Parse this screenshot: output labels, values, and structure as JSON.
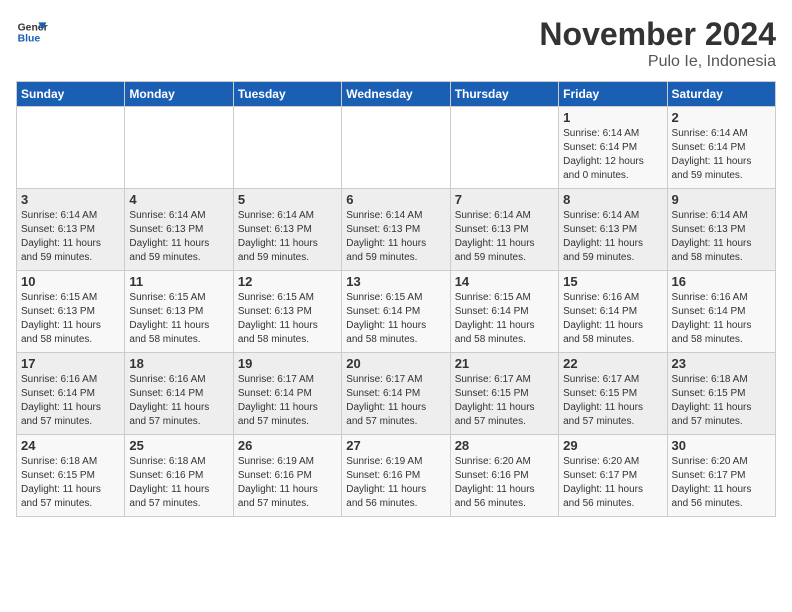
{
  "logo": {
    "line1": "General",
    "line2": "Blue"
  },
  "title": "November 2024",
  "location": "Pulo Ie, Indonesia",
  "days_of_week": [
    "Sunday",
    "Monday",
    "Tuesday",
    "Wednesday",
    "Thursday",
    "Friday",
    "Saturday"
  ],
  "weeks": [
    [
      {
        "day": "",
        "text": ""
      },
      {
        "day": "",
        "text": ""
      },
      {
        "day": "",
        "text": ""
      },
      {
        "day": "",
        "text": ""
      },
      {
        "day": "",
        "text": ""
      },
      {
        "day": "1",
        "text": "Sunrise: 6:14 AM\nSunset: 6:14 PM\nDaylight: 12 hours\nand 0 minutes."
      },
      {
        "day": "2",
        "text": "Sunrise: 6:14 AM\nSunset: 6:14 PM\nDaylight: 11 hours\nand 59 minutes."
      }
    ],
    [
      {
        "day": "3",
        "text": "Sunrise: 6:14 AM\nSunset: 6:13 PM\nDaylight: 11 hours\nand 59 minutes."
      },
      {
        "day": "4",
        "text": "Sunrise: 6:14 AM\nSunset: 6:13 PM\nDaylight: 11 hours\nand 59 minutes."
      },
      {
        "day": "5",
        "text": "Sunrise: 6:14 AM\nSunset: 6:13 PM\nDaylight: 11 hours\nand 59 minutes."
      },
      {
        "day": "6",
        "text": "Sunrise: 6:14 AM\nSunset: 6:13 PM\nDaylight: 11 hours\nand 59 minutes."
      },
      {
        "day": "7",
        "text": "Sunrise: 6:14 AM\nSunset: 6:13 PM\nDaylight: 11 hours\nand 59 minutes."
      },
      {
        "day": "8",
        "text": "Sunrise: 6:14 AM\nSunset: 6:13 PM\nDaylight: 11 hours\nand 59 minutes."
      },
      {
        "day": "9",
        "text": "Sunrise: 6:14 AM\nSunset: 6:13 PM\nDaylight: 11 hours\nand 58 minutes."
      }
    ],
    [
      {
        "day": "10",
        "text": "Sunrise: 6:15 AM\nSunset: 6:13 PM\nDaylight: 11 hours\nand 58 minutes."
      },
      {
        "day": "11",
        "text": "Sunrise: 6:15 AM\nSunset: 6:13 PM\nDaylight: 11 hours\nand 58 minutes."
      },
      {
        "day": "12",
        "text": "Sunrise: 6:15 AM\nSunset: 6:13 PM\nDaylight: 11 hours\nand 58 minutes."
      },
      {
        "day": "13",
        "text": "Sunrise: 6:15 AM\nSunset: 6:14 PM\nDaylight: 11 hours\nand 58 minutes."
      },
      {
        "day": "14",
        "text": "Sunrise: 6:15 AM\nSunset: 6:14 PM\nDaylight: 11 hours\nand 58 minutes."
      },
      {
        "day": "15",
        "text": "Sunrise: 6:16 AM\nSunset: 6:14 PM\nDaylight: 11 hours\nand 58 minutes."
      },
      {
        "day": "16",
        "text": "Sunrise: 6:16 AM\nSunset: 6:14 PM\nDaylight: 11 hours\nand 58 minutes."
      }
    ],
    [
      {
        "day": "17",
        "text": "Sunrise: 6:16 AM\nSunset: 6:14 PM\nDaylight: 11 hours\nand 57 minutes."
      },
      {
        "day": "18",
        "text": "Sunrise: 6:16 AM\nSunset: 6:14 PM\nDaylight: 11 hours\nand 57 minutes."
      },
      {
        "day": "19",
        "text": "Sunrise: 6:17 AM\nSunset: 6:14 PM\nDaylight: 11 hours\nand 57 minutes."
      },
      {
        "day": "20",
        "text": "Sunrise: 6:17 AM\nSunset: 6:14 PM\nDaylight: 11 hours\nand 57 minutes."
      },
      {
        "day": "21",
        "text": "Sunrise: 6:17 AM\nSunset: 6:15 PM\nDaylight: 11 hours\nand 57 minutes."
      },
      {
        "day": "22",
        "text": "Sunrise: 6:17 AM\nSunset: 6:15 PM\nDaylight: 11 hours\nand 57 minutes."
      },
      {
        "day": "23",
        "text": "Sunrise: 6:18 AM\nSunset: 6:15 PM\nDaylight: 11 hours\nand 57 minutes."
      }
    ],
    [
      {
        "day": "24",
        "text": "Sunrise: 6:18 AM\nSunset: 6:15 PM\nDaylight: 11 hours\nand 57 minutes."
      },
      {
        "day": "25",
        "text": "Sunrise: 6:18 AM\nSunset: 6:16 PM\nDaylight: 11 hours\nand 57 minutes."
      },
      {
        "day": "26",
        "text": "Sunrise: 6:19 AM\nSunset: 6:16 PM\nDaylight: 11 hours\nand 57 minutes."
      },
      {
        "day": "27",
        "text": "Sunrise: 6:19 AM\nSunset: 6:16 PM\nDaylight: 11 hours\nand 56 minutes."
      },
      {
        "day": "28",
        "text": "Sunrise: 6:20 AM\nSunset: 6:16 PM\nDaylight: 11 hours\nand 56 minutes."
      },
      {
        "day": "29",
        "text": "Sunrise: 6:20 AM\nSunset: 6:17 PM\nDaylight: 11 hours\nand 56 minutes."
      },
      {
        "day": "30",
        "text": "Sunrise: 6:20 AM\nSunset: 6:17 PM\nDaylight: 11 hours\nand 56 minutes."
      }
    ]
  ]
}
